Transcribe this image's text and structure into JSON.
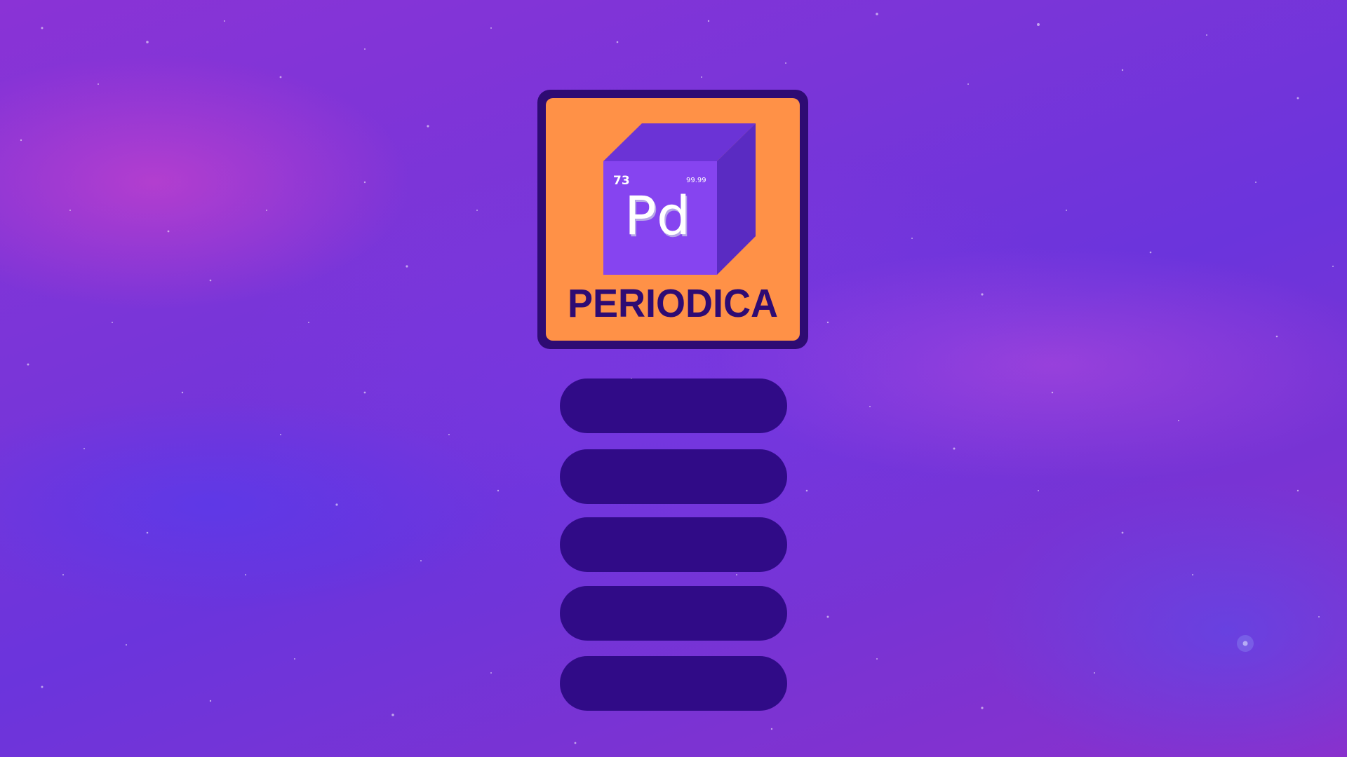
{
  "logo": {
    "element_number": "73",
    "element_mass": "99.99",
    "element_symbol": "Pd",
    "title": "PERIODICA"
  },
  "menu": {
    "buttons": [
      {
        "label": ""
      },
      {
        "label": ""
      },
      {
        "label": ""
      },
      {
        "label": ""
      },
      {
        "label": ""
      }
    ]
  },
  "colors": {
    "logo_orange": "#ff9147",
    "logo_dark_purple": "#2e0b73",
    "cube_front": "#8644f0",
    "cube_top": "#6b33d6",
    "cube_side": "#5a2bc2",
    "button_fill": "#300b87"
  }
}
